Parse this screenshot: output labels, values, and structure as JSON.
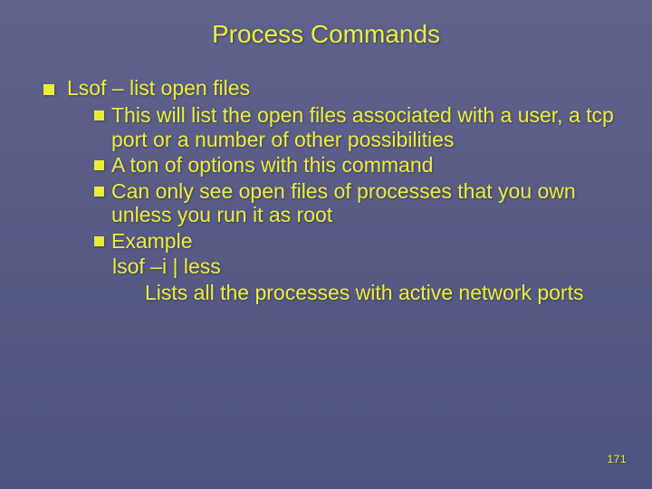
{
  "title": "Process Commands",
  "bullets": {
    "lvl1": "Lsof – list open files",
    "sub1": "This will list the open files associated with a user, a tcp port or a number of other possibilities",
    "sub2": "A ton of options with this command",
    "sub3": "Can only see open files of processes that you own unless you run it as root",
    "sub4": "Example",
    "sub4a": "lsof –i | less",
    "sub4b": "Lists all the processes with active network ports"
  },
  "pagenum": "171"
}
